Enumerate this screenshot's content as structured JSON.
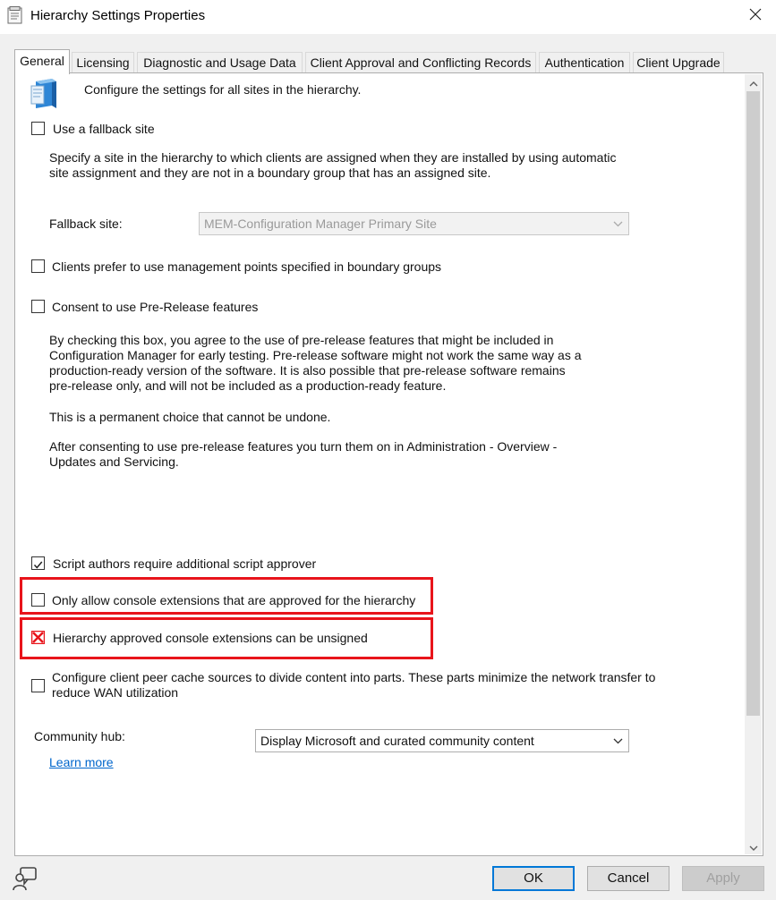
{
  "window": {
    "title": "Hierarchy Settings Properties",
    "icon": "properties-sheet-icon",
    "close_glyph": "✕"
  },
  "tabs": [
    {
      "label": "General",
      "active": true
    },
    {
      "label": "Licensing",
      "active": false
    },
    {
      "label": "Diagnostic and Usage Data",
      "active": false
    },
    {
      "label": "Client Approval and Conflicting Records",
      "active": false
    },
    {
      "label": "Authentication",
      "active": false
    },
    {
      "label": "Client Upgrade",
      "active": false
    }
  ],
  "general": {
    "header_text": "Configure the settings for all sites in the hierarchy.",
    "fallback": {
      "checkbox_label": "Use a fallback site",
      "checked": false,
      "description_lines": [
        "Specify a site in the hierarchy to which clients are assigned when they are installed by using automatic",
        "site assignment and they are not in a boundary group that has an assigned site."
      ],
      "field_label": "Fallback site:",
      "field_value": "MEM-Configuration Manager Primary Site"
    },
    "prefer_mp": {
      "checkbox_label": "Clients prefer to use management points specified in boundary groups",
      "checked": false
    },
    "prerelease": {
      "checkbox_label": "Consent to use Pre-Release features",
      "checked": false,
      "paragraph1_lines": [
        "By checking this box, you agree to the use of pre-release features that might be included in",
        "Configuration Manager for early testing. Pre-release software might not work the same way as a",
        "production-ready version of the software. It is also possible that pre-release software remains",
        "pre-release only, and will not be included as a production-ready feature."
      ],
      "paragraph2": "This is a permanent choice that cannot be undone.",
      "paragraph3_lines": [
        "After consenting to use pre-release features you turn them on in Administration - Overview -",
        "Updates and Servicing."
      ]
    },
    "script_approver": {
      "checkbox_label": "Script authors require additional script approver",
      "checked": true
    },
    "console_extensions_approved": {
      "checkbox_label": "Only allow console extensions that are approved for the hierarchy",
      "checked": false
    },
    "console_extensions_unsigned": {
      "checkbox_label": "Hierarchy approved console extensions can be unsigned",
      "checked": false
    },
    "peer_cache": {
      "checkbox_label_lines": [
        "Configure client peer cache sources to divide content into parts. These parts minimize the network transfer to",
        "reduce WAN utilization"
      ],
      "checked": false
    },
    "community_hub": {
      "label": "Community hub:",
      "value": "Display Microsoft and curated community content",
      "learn_more": "Learn more"
    }
  },
  "buttons": {
    "ok": "OK",
    "cancel": "Cancel",
    "apply": "Apply"
  },
  "colors": {
    "highlight": "#e8141b",
    "link": "#0066cc",
    "default_button_border": "#0078d7"
  }
}
